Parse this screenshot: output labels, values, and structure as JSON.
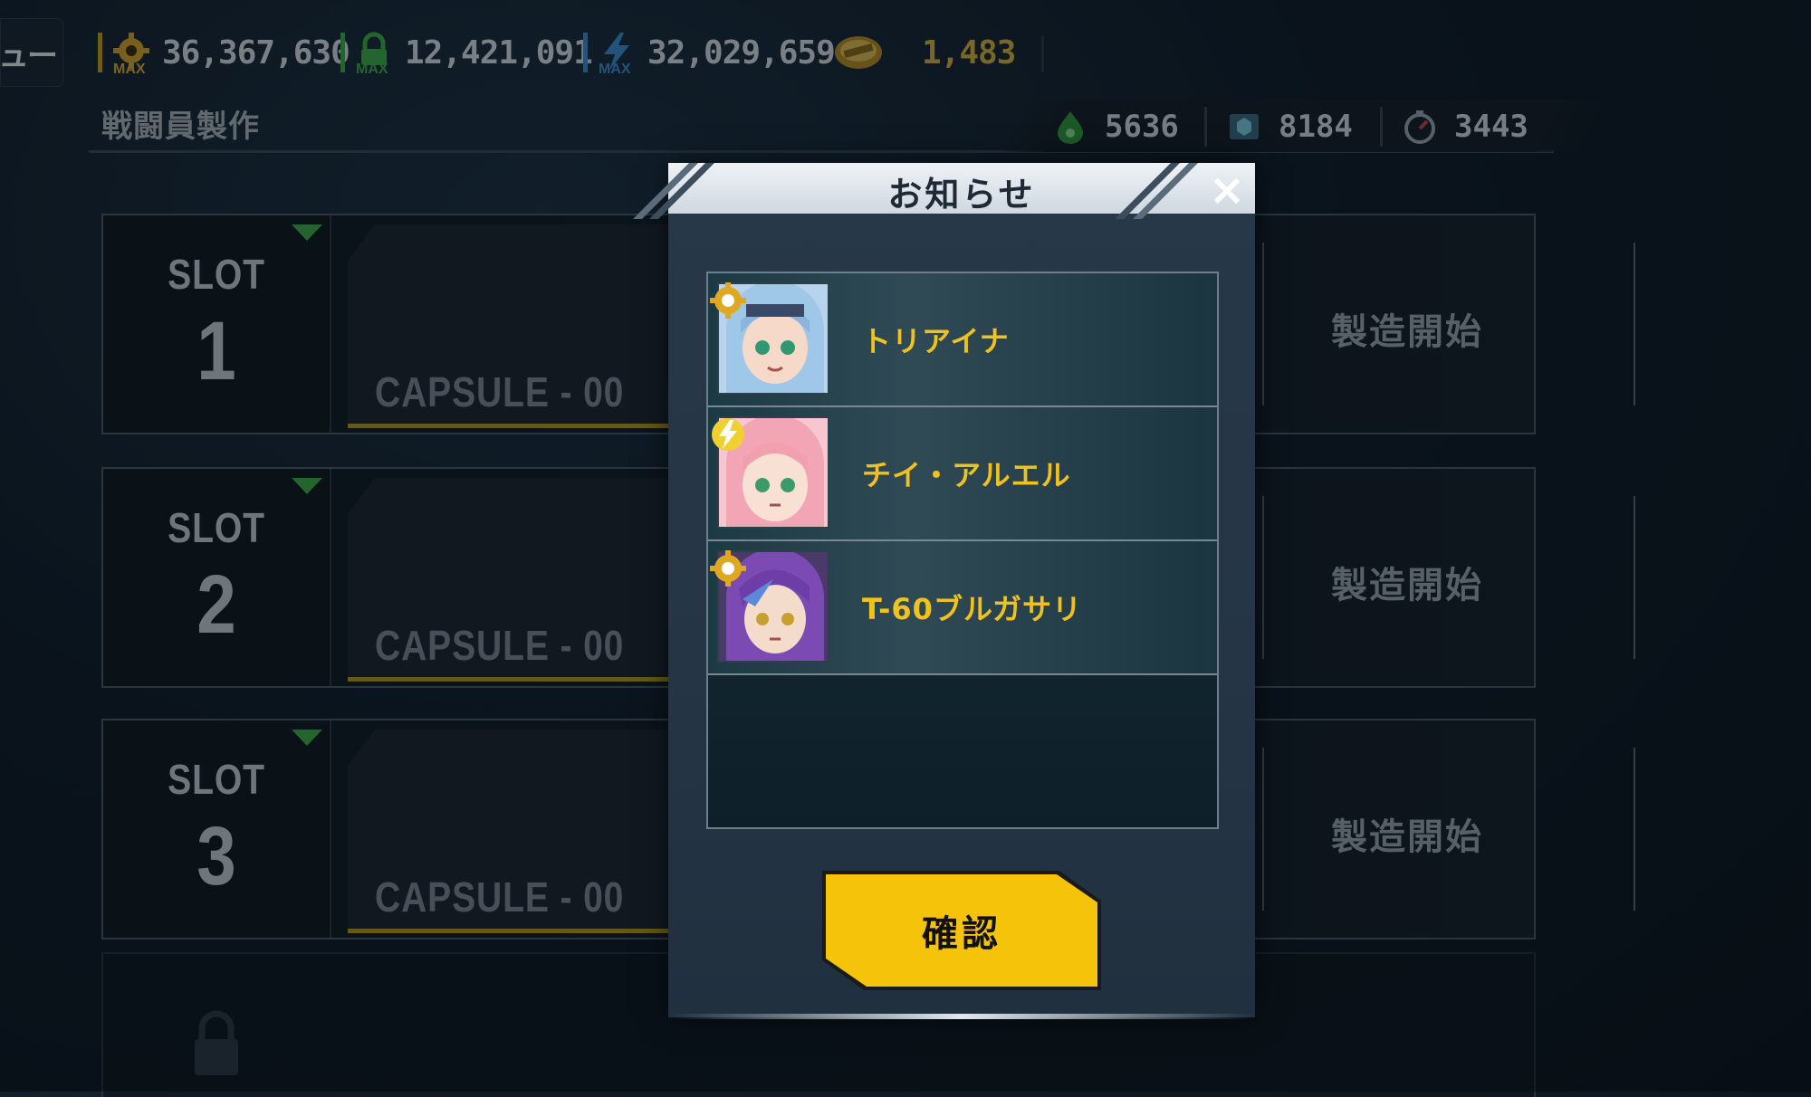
{
  "menu": {
    "label": "ュー"
  },
  "resources": [
    {
      "name": "gear",
      "value": "36,367,630",
      "tag": "MAX",
      "color": "#d9a52a"
    },
    {
      "name": "lock",
      "value": "12,421,091",
      "tag": "MAX",
      "color": "#3fb04a"
    },
    {
      "name": "bolt",
      "value": "32,029,659",
      "tag": "MAX",
      "color": "#3a8fd6"
    },
    {
      "name": "coin",
      "value": "1,483",
      "tag": "",
      "color": "#c9a12b"
    }
  ],
  "screen_title": "戦闘員製作",
  "materials": [
    {
      "name": "green-drop",
      "value": "5636"
    },
    {
      "name": "chip",
      "value": "8184"
    },
    {
      "name": "gauge",
      "value": "3443"
    }
  ],
  "slots": [
    {
      "word": "SLOT",
      "number": "1",
      "capsule": "CAPSULE - 00",
      "start": "製造開始"
    },
    {
      "word": "SLOT",
      "number": "2",
      "capsule": "CAPSULE - 00",
      "start": "製造開始"
    },
    {
      "word": "SLOT",
      "number": "3",
      "capsule": "CAPSULE - 00",
      "start": "製造開始"
    }
  ],
  "modal": {
    "title": "お知らせ",
    "close": "×",
    "items": [
      {
        "name": "トリアイナ",
        "hair": "#9fc7e8",
        "badge": "gear"
      },
      {
        "name": "チイ・アルエル",
        "hair": "#f2a6b5",
        "badge": "bolt"
      },
      {
        "name": "T-60ブルガサリ",
        "hair": "#7b4bb3",
        "badge": "gear"
      }
    ],
    "confirm": "確認"
  },
  "colors": {
    "accent": "#f5c40a",
    "name_text": "#f2c21c",
    "slot_marker": "#3fb04a"
  }
}
